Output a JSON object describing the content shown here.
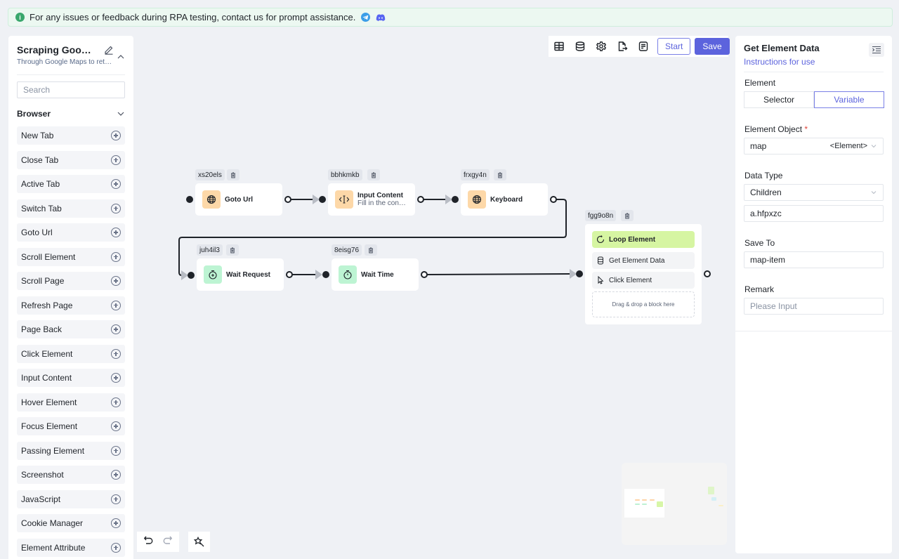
{
  "banner": {
    "message": "For any issues or feedback during RPA testing, contact us for prompt assistance.",
    "icons": [
      "info-icon",
      "telegram-icon",
      "discord-icon"
    ]
  },
  "sidebar": {
    "workflow_title": "Scraping Google...",
    "workflow_subtitle": "Through Google Maps to retr...",
    "search_placeholder": "Search",
    "group_label": "Browser",
    "items": [
      {
        "label": "New Tab"
      },
      {
        "label": "Close Tab"
      },
      {
        "label": "Active Tab"
      },
      {
        "label": "Switch Tab"
      },
      {
        "label": "Goto Url"
      },
      {
        "label": "Scroll Element"
      },
      {
        "label": "Scroll Page"
      },
      {
        "label": "Refresh Page"
      },
      {
        "label": "Page Back"
      },
      {
        "label": "Click Element"
      },
      {
        "label": "Input Content"
      },
      {
        "label": "Hover Element"
      },
      {
        "label": "Focus Element"
      },
      {
        "label": "Passing Element"
      },
      {
        "label": "Screenshot"
      },
      {
        "label": "JavaScript"
      },
      {
        "label": "Cookie Manager"
      },
      {
        "label": "Element Attribute"
      }
    ]
  },
  "toolbar": {
    "icons": [
      "table-icon",
      "database-icon",
      "settings-icon",
      "export-icon",
      "notes-icon"
    ],
    "start_label": "Start",
    "save_label": "Save"
  },
  "canvas": {
    "nodes": [
      {
        "id": "xs20els",
        "title": "Goto Url",
        "desc": "",
        "icon": "globe-icon",
        "color": "orange"
      },
      {
        "id": "bbhkmkb",
        "title": "Input Content",
        "desc": "Fill in the content",
        "icon": "text-cursor-icon",
        "color": "orange"
      },
      {
        "id": "frxgy4n",
        "title": "Keyboard",
        "desc": "",
        "icon": "globe-icon",
        "color": "orange"
      },
      {
        "id": "juh4il3",
        "title": "Wait Request",
        "desc": "",
        "icon": "timer-icon",
        "color": "green"
      },
      {
        "id": "8eisg76",
        "title": "Wait Time",
        "desc": "",
        "icon": "timer-icon",
        "color": "green"
      }
    ],
    "loop_block": {
      "id": "fgg9o8n",
      "title": "Loop Element",
      "children": [
        {
          "label": "Get Element Data",
          "icon": "database-icon"
        },
        {
          "label": "Click Element",
          "icon": "cursor-icon"
        }
      ],
      "drop_hint": "Drag & drop a block here"
    }
  },
  "right_panel": {
    "title": "Get Element Data",
    "instructions_link": "Instructions for use",
    "element_label": "Element",
    "element_options": [
      "Selector",
      "Variable"
    ],
    "element_selected": "Variable",
    "element_object_label": "Element Object",
    "element_object_required": "*",
    "element_object_value": "map",
    "element_object_type": "<Element>",
    "data_type_label": "Data Type",
    "data_type_value": "Children",
    "selector_value": "a.hfpxzc",
    "save_to_label": "Save To",
    "save_to_value": "map-item",
    "remark_label": "Remark",
    "remark_placeholder": "Please Input"
  },
  "colors": {
    "accent": "#5c63dd",
    "banner_bg": "#ecf8f1",
    "node_orange": "#fdd8a8",
    "node_green": "#bdf4d3",
    "loop_active": "#d6f5a2"
  }
}
